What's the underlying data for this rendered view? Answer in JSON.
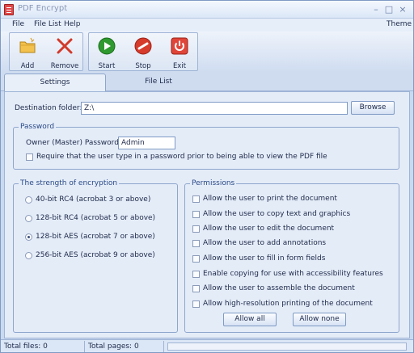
{
  "window": {
    "title": "PDF Encrypt"
  },
  "menu": {
    "file": "File",
    "filelist": "File List",
    "help": "Help",
    "theme": "Theme"
  },
  "toolbar": {
    "add": "Add",
    "remove": "Remove",
    "start": "Start",
    "stop": "Stop",
    "exit": "Exit"
  },
  "tabs": {
    "settings": "Settings",
    "filelist": "File List"
  },
  "settings": {
    "dest_label": "Destination folder:",
    "dest_value": "Z:\\",
    "browse": "Browse",
    "password_group": "Password",
    "owner_label": "Owner (Master) Password:",
    "owner_value": "Admin",
    "require_label": "Require that the user type in a password prior to being able to view the PDF file"
  },
  "encryption": {
    "title": "The strength of encryption",
    "selected": "128-bit AES (acrobat 7 or above)",
    "options": [
      "40-bit RC4 (acrobat 3 or above)",
      "128-bit RC4 (acrobat 5 or above)",
      "128-bit AES (acrobat 7 or above)",
      "256-bit AES (acrobat 9 or above)"
    ]
  },
  "permissions": {
    "title": "Permissions",
    "items": [
      "Allow the user to print the document",
      "Allow the user to copy text and graphics",
      "Allow the user to edit the document",
      "Allow the user to add annotations",
      "Allow the user to fill in form fields",
      "Enable copying for use with accessibility features",
      "Allow the user to assemble the document",
      "Allow high-resolution printing of the document"
    ],
    "allow_all": "Allow all",
    "allow_none": "Allow none"
  },
  "status": {
    "files": "Total files: 0",
    "pages": "Total pages: 0",
    "progress": 0
  },
  "icons": {
    "add": "folder-add-icon",
    "remove": "red-x-icon",
    "start": "green-play-icon",
    "stop": "red-stop-icon",
    "exit": "power-icon"
  },
  "colors": {
    "accent": "#2b4a86",
    "start": "#2f9a2f",
    "stop": "#d63b2b"
  }
}
